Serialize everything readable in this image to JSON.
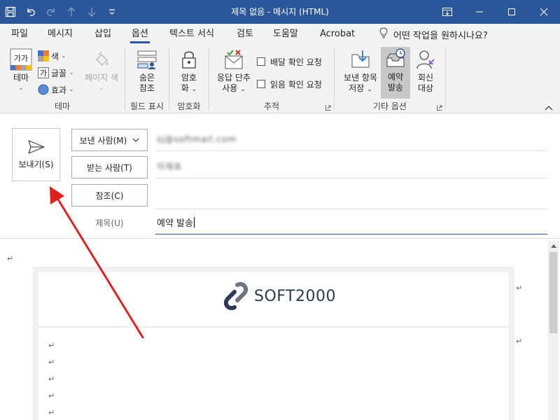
{
  "window": {
    "title": "제목 없음 - 메시지 (HTML)"
  },
  "qat": {
    "icons": [
      "save-icon",
      "undo-icon",
      "redo-icon",
      "up-icon",
      "down-icon",
      "customize-icon"
    ]
  },
  "menu": {
    "tabs": [
      {
        "label": "파일"
      },
      {
        "label": "메시지"
      },
      {
        "label": "삽입"
      },
      {
        "label": "옵션",
        "active": true
      },
      {
        "label": "텍스트 서식"
      },
      {
        "label": "검토"
      },
      {
        "label": "도움말"
      },
      {
        "label": "Acrobat"
      }
    ],
    "tell_me": "어떤 작업을 원하시나요?"
  },
  "ribbon": {
    "theme_group": {
      "label": "테마",
      "theme_btn": "테마",
      "theme_icon_text": "가가",
      "colors": "색",
      "fonts_icon_text": "가",
      "fonts": "글꼴",
      "effects": "효과",
      "page_color": "페이지 색"
    },
    "show_fields_group": {
      "label": "필드 표시",
      "bcc_line1": "숨은",
      "bcc_line2": "참조"
    },
    "encrypt_group": {
      "label": "암호화",
      "encrypt_line1": "암호",
      "encrypt_line2": "화"
    },
    "tracking_group": {
      "label": "추적",
      "voting_line1": "응답 단추",
      "voting_line2": "사용",
      "delivery_receipt": "배달 확인 요청",
      "read_receipt": "읽음 확인 요청"
    },
    "more_options_group": {
      "label": "기타 옵션",
      "save_sent_line1": "보낸 항목",
      "save_sent_line2": "저장",
      "delay_line1": "예약",
      "delay_line2": "발송",
      "reply_line1": "회신",
      "reply_line2": "대상"
    }
  },
  "compose": {
    "send_label": "보내기(S)",
    "from_label": "보낸 사람(M)",
    "from_value": "sj@softmail.com",
    "to_label": "받는 사람(T)",
    "to_value": "이재호",
    "cc_label": "참조(C)",
    "cc_value": "",
    "subject_label": "제목(U)",
    "subject_value": "예약 발송"
  },
  "body": {
    "para_mark": "↵",
    "logo_text": "SOFT2000"
  },
  "colors": {
    "accent": "#2b579a",
    "annotation": "#e02020"
  }
}
